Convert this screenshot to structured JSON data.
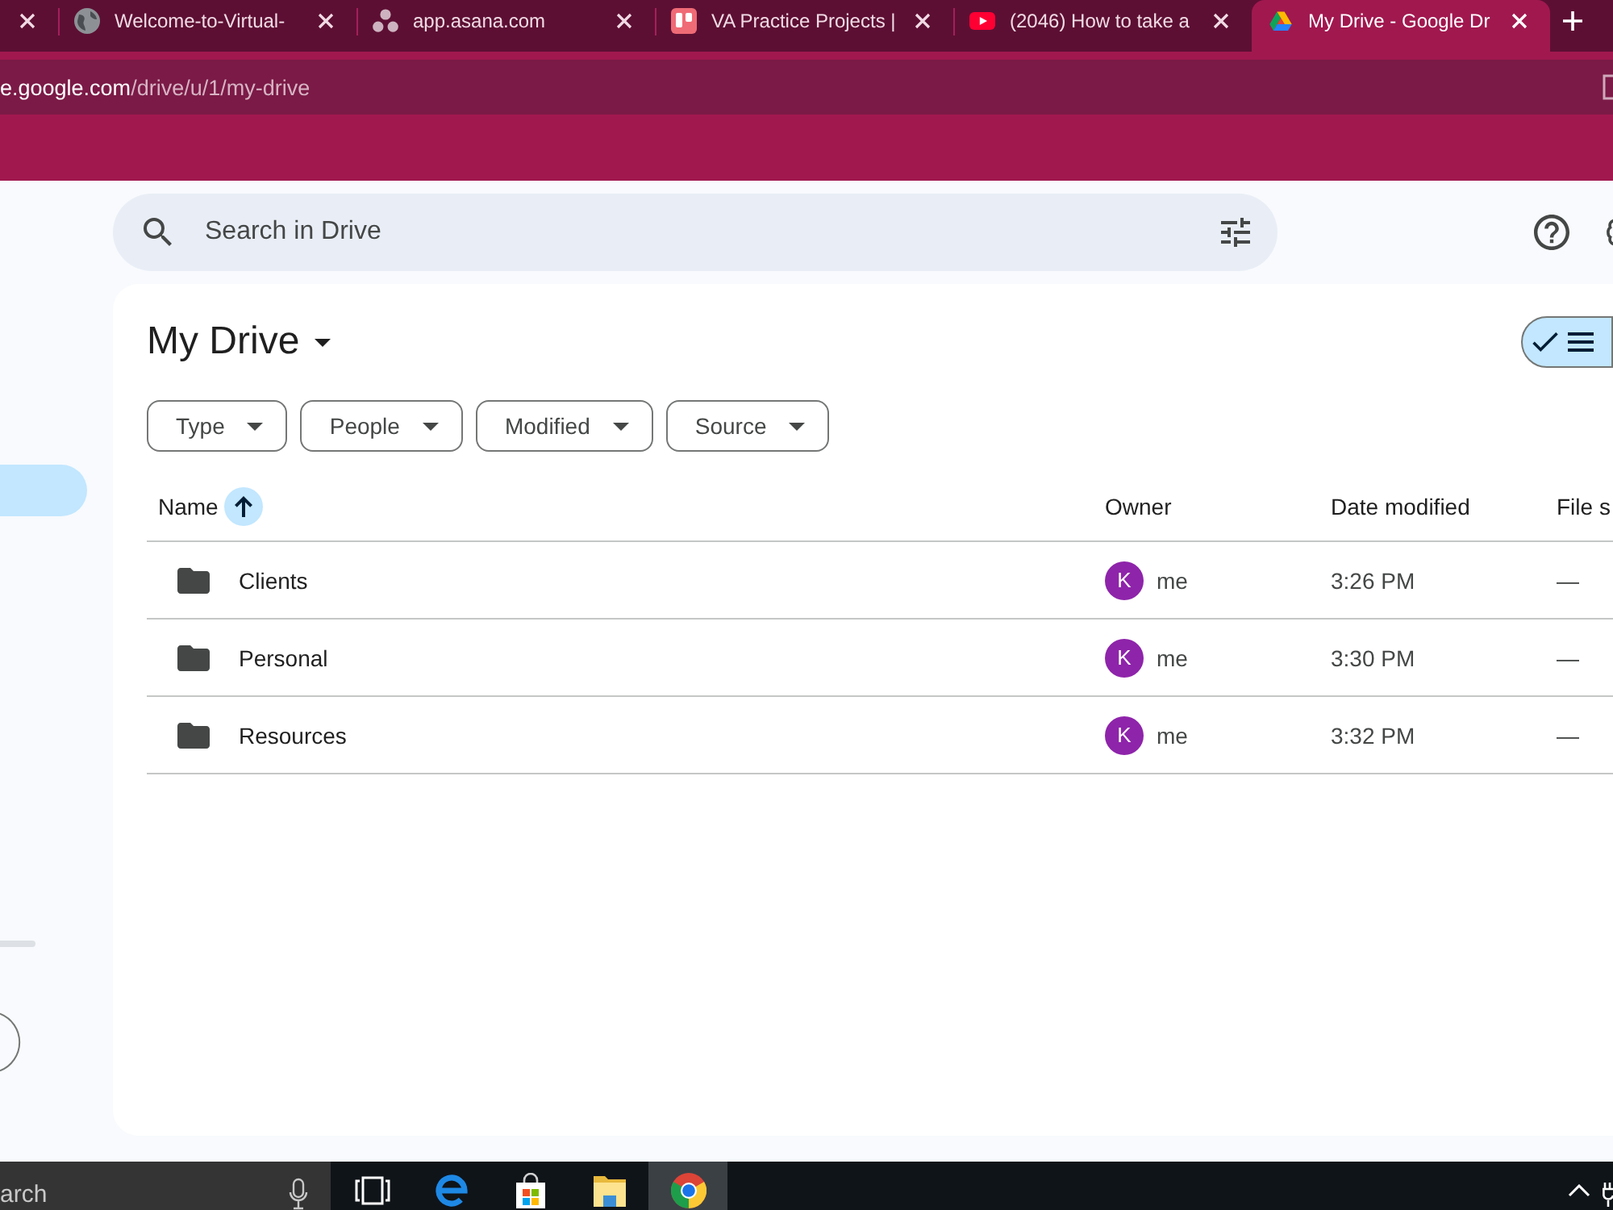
{
  "browser": {
    "tabs": [
      {
        "kind": "cut",
        "selected": false
      },
      {
        "kind": "page",
        "title": "Welcome-to-Virtual-",
        "selected": false
      },
      {
        "kind": "page",
        "title": "app.asana.com",
        "selected": false
      },
      {
        "kind": "page",
        "title": "VA Practice Projects |",
        "selected": false
      },
      {
        "kind": "page",
        "title": "(2046) How to take a",
        "selected": false
      },
      {
        "kind": "page",
        "title": "My Drive - Google Dr",
        "selected": true
      }
    ],
    "address": {
      "host": "e.google.com",
      "path": "/drive/u/1/my-drive"
    }
  },
  "drive": {
    "sidebar": {
      "items": [
        {
          "selected": true
        }
      ]
    },
    "search": {
      "placeholder": "Search in Drive"
    },
    "title": "My Drive",
    "view_toggle": {
      "selected": true
    },
    "filters": [
      {
        "label": "Type"
      },
      {
        "label": "People"
      },
      {
        "label": "Modified"
      },
      {
        "label": "Source"
      }
    ],
    "table": {
      "columns": [
        {
          "label": "Name",
          "sorted": true
        },
        {
          "label": "Owner",
          "sorted": false
        },
        {
          "label": "Date modified",
          "sorted": false
        },
        {
          "label": "File s",
          "sorted": false
        }
      ],
      "rows": [
        {
          "name": "Clients",
          "owner_initial": "K",
          "owner": "me",
          "modified": "3:26 PM",
          "size": "—"
        },
        {
          "name": "Personal",
          "owner_initial": "K",
          "owner": "me",
          "modified": "3:30 PM",
          "size": "—"
        },
        {
          "name": "Resources",
          "owner_initial": "K",
          "owner": "me",
          "modified": "3:32 PM",
          "size": "—"
        }
      ]
    }
  },
  "taskbar": {
    "search": {
      "placeholder": "arch"
    },
    "buttons": [
      {
        "selected": false
      },
      {
        "selected": false
      },
      {
        "selected": false
      },
      {
        "selected": false
      },
      {
        "selected": true
      }
    ]
  }
}
